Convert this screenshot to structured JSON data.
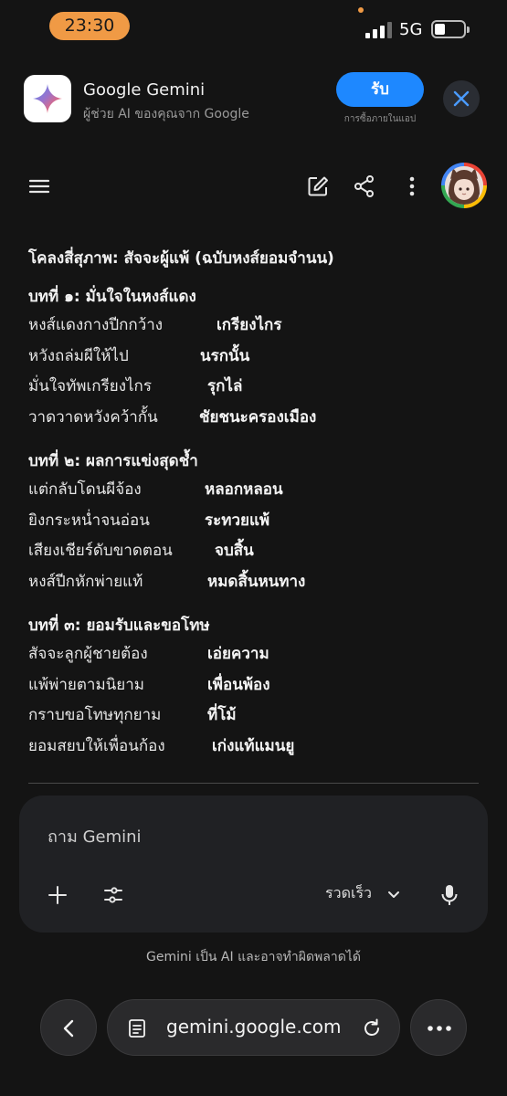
{
  "status_bar": {
    "time": "23:30",
    "network": "5G"
  },
  "app_banner": {
    "app_name": "Google Gemini",
    "subtitle": "ผู้ช่วย AI ของคุณจาก Google",
    "get_label": "รับ",
    "get_note": "การซื้อภายในแอป"
  },
  "poem": {
    "title": "โคลงสี่สุภาพ: สัจจะผู้แพ้ (ฉบับหงส์ยอมจำนน)",
    "sections": [
      {
        "heading": "บทที่ ๑: มั่นใจในหงส์แดง",
        "lines": [
          {
            "left": "หงส์แดงกางปีกกว้าง",
            "right": "เกรียงไกร"
          },
          {
            "left": "หวังถล่มผีให้ไป",
            "right": "นรกนั้น"
          },
          {
            "left": "มั่นใจทัพเกรียงไกร",
            "right": "รุกไล่"
          },
          {
            "left": "วาดวาดหวังคว้ากั้น",
            "right": "ชัยชนะครองเมือง"
          }
        ]
      },
      {
        "heading": "บทที่ ๒: ผลการแข่งสุดช้ำ",
        "lines": [
          {
            "left": "แต่กลับโดนผีจ้อง",
            "right": "หลอกหลอน"
          },
          {
            "left": "ยิงกระหน่ำจนอ่อน",
            "right": "ระทวยแพ้"
          },
          {
            "left": "เสียงเชียร์ดับขาดตอน",
            "right": "จบสิ้น"
          },
          {
            "left": "หงส์ปีกหักพ่ายแท้",
            "right": "หมดสิ้นหนทาง"
          }
        ]
      },
      {
        "heading": "บทที่ ๓: ยอมรับและขอโทษ",
        "lines": [
          {
            "left": "สัจจะลูกผู้ชายต้อง",
            "right": "เอ่ยความ"
          },
          {
            "left": "แพ้พ่ายตามนิยาม",
            "right": "เพื่อนพ้อง"
          },
          {
            "left": "กราบขอโทษทุกยาม",
            "right": "ที่โม้"
          },
          {
            "left": "ยอมสยบให้เพื่อนก้อง",
            "right": "เก่งแท้แมนยู"
          }
        ]
      }
    ]
  },
  "input": {
    "placeholder": "ถาม Gemini",
    "speed_label": "รวดเร็ว"
  },
  "disclaimer": "Gemini เป็น AI และอาจทำผิดพลาดได้",
  "browser": {
    "url": "gemini.google.com"
  },
  "icons": {
    "menu": "menu-icon",
    "edit": "edit-icon",
    "share": "share-icon",
    "more": "more-vert-icon",
    "plus": "plus-icon",
    "tools": "tools-icon",
    "chevron": "chevron-down-icon",
    "mic": "mic-icon",
    "back": "back-icon",
    "page": "page-icon",
    "reload": "reload-icon",
    "more_h": "more-horiz-icon"
  },
  "colors": {
    "accent_orange": "#f09a45",
    "get_button": "#1e88ff",
    "background": "#141414"
  }
}
